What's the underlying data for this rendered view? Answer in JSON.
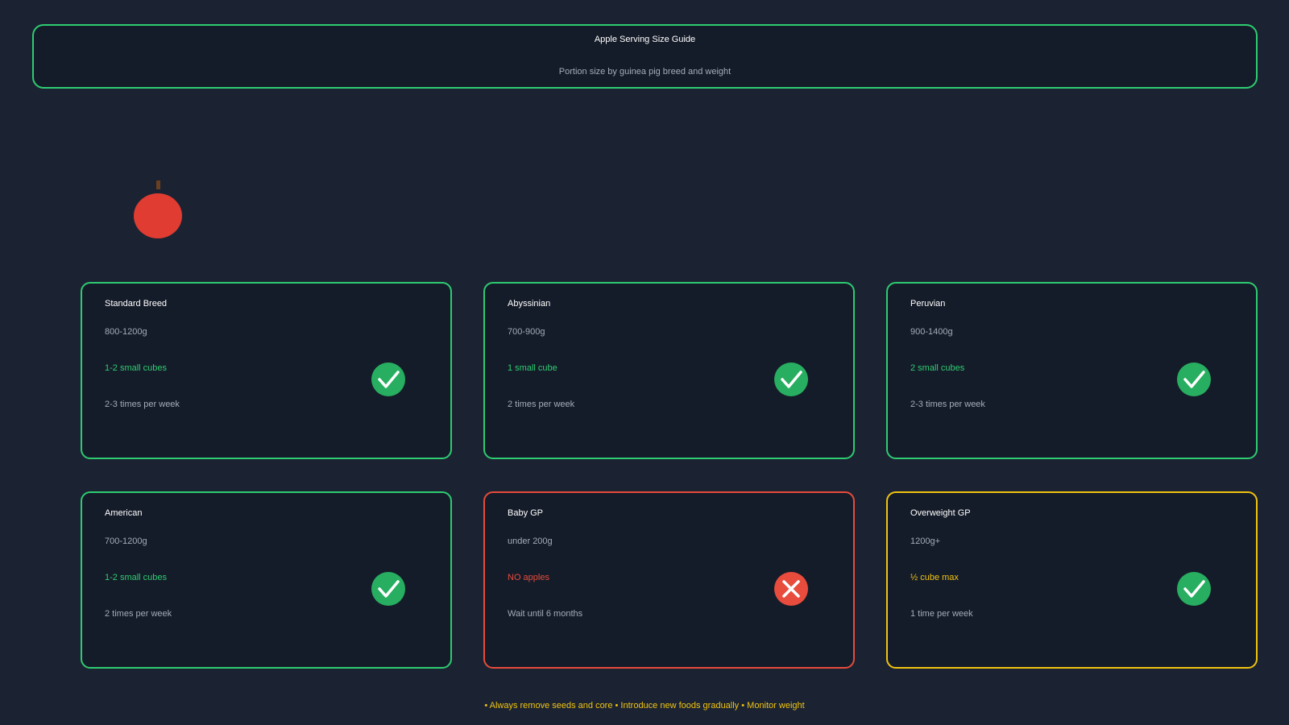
{
  "header": {
    "title": "Apple Serving Size Guide",
    "subtitle": "Portion size by guinea pig breed and weight"
  },
  "colors": {
    "background": "#1b2333",
    "panel": "#151c29",
    "safe": "#2ecc71",
    "danger": "#e74c3c",
    "caution": "#f1c40f",
    "apple": "#e03c31",
    "stem": "#6b3f1f"
  },
  "cards": [
    {
      "title": "Standard Breed",
      "weight": "800-1200g",
      "portion": "1-2 small cubes",
      "frequency": "2-3 times per week",
      "status": "check-icon"
    },
    {
      "title": "Abyssinian",
      "weight": "700-900g",
      "portion": "1 small cube",
      "frequency": "2 times per week",
      "status": "check-icon"
    },
    {
      "title": "Peruvian",
      "weight": "900-1400g",
      "portion": "2 small cubes",
      "frequency": "2-3 times per week",
      "status": "check-icon"
    },
    {
      "title": "American",
      "weight": "700-1200g",
      "portion": "1-2 small cubes",
      "frequency": "2 times per week",
      "status": "check-icon"
    },
    {
      "title": "Baby GP",
      "weight": "under 200g",
      "portion": "NO apples",
      "frequency": "Wait until 6 months",
      "status": "cross-icon"
    },
    {
      "title": "Overweight GP",
      "weight": "1200g+",
      "portion": "½ cube max",
      "frequency": "1 time per week",
      "status": "check-icon"
    }
  ],
  "footer": {
    "note": "• Always remove seeds and core • Introduce new foods gradually • Monitor weight"
  }
}
